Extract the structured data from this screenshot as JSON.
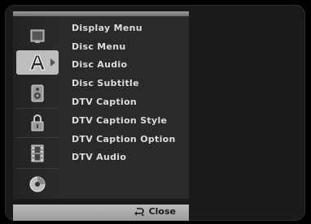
{
  "menu": {
    "items": [
      {
        "label": "Display Menu"
      },
      {
        "label": "Disc Menu"
      },
      {
        "label": "Disc Audio"
      },
      {
        "label": "Disc Subtitle"
      },
      {
        "label": "DTV Caption"
      },
      {
        "label": "DTV Caption Style"
      },
      {
        "label": "DTV Caption Option"
      },
      {
        "label": "DTV Audio"
      }
    ]
  },
  "sidebar": {
    "items": [
      {
        "icon": "tv-screen-icon"
      },
      {
        "icon": "language-a-icon",
        "selected": true
      },
      {
        "icon": "speaker-icon"
      },
      {
        "icon": "lock-icon"
      },
      {
        "icon": "film-icon"
      },
      {
        "icon": "disc-icon"
      }
    ]
  },
  "footer": {
    "close_label": "Close",
    "close_icon": "return-icon"
  }
}
